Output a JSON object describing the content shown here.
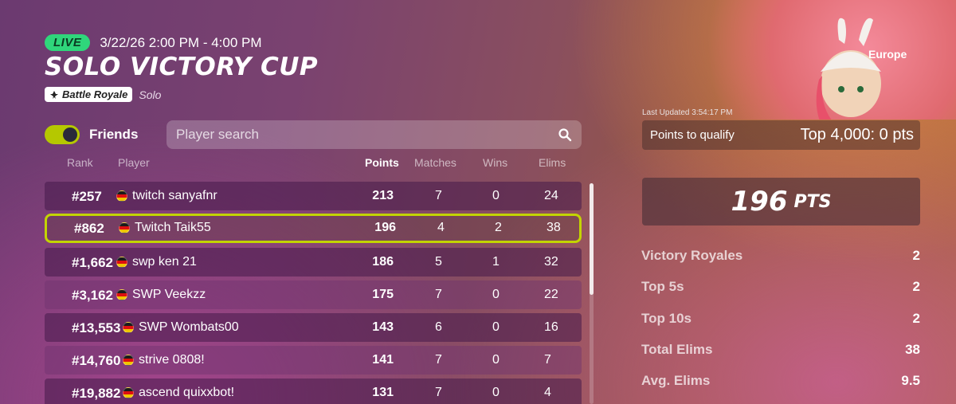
{
  "event": {
    "live_label": "LIVE",
    "time_range": "3/22/26 2:00 PM - 4:00 PM",
    "title": "SOLO VICTORY CUP",
    "mode": "Battle Royale",
    "mode_sub": "Solo"
  },
  "filters": {
    "friends_label": "Friends",
    "friends_on": true,
    "search_placeholder": "Player search"
  },
  "table": {
    "headers": {
      "rank": "Rank",
      "player": "Player",
      "points": "Points",
      "matches": "Matches",
      "wins": "Wins",
      "elims": "Elims"
    },
    "rows": [
      {
        "rank": "#257",
        "player": "twitch sanyafnr",
        "points": "213",
        "matches": "7",
        "wins": "0",
        "elims": "24"
      },
      {
        "rank": "#862",
        "player": "Twitch Taik55",
        "points": "196",
        "matches": "4",
        "wins": "2",
        "elims": "38"
      },
      {
        "rank": "#1,662",
        "player": "swp ken 21",
        "points": "186",
        "matches": "5",
        "wins": "1",
        "elims": "32"
      },
      {
        "rank": "#3,162",
        "player": "SWP Veekzz",
        "points": "175",
        "matches": "7",
        "wins": "0",
        "elims": "22"
      },
      {
        "rank": "#13,553",
        "player": "SWP Wombats00",
        "points": "143",
        "matches": "6",
        "wins": "0",
        "elims": "16"
      },
      {
        "rank": "#14,760",
        "player": "strive 0808!",
        "points": "141",
        "matches": "7",
        "wins": "0",
        "elims": "7"
      },
      {
        "rank": "#19,882",
        "player": "ascend quixxbot!",
        "points": "131",
        "matches": "7",
        "wins": "0",
        "elims": "4"
      }
    ]
  },
  "summary": {
    "region": "Europe",
    "last_updated": "Last Updated 3:54:17 PM",
    "qualify_label": "Points to qualify",
    "qualify_value": "Top 4,000: 0 pts",
    "points": "196",
    "points_unit": "PTS",
    "stats": [
      {
        "label": "Victory Royales",
        "value": "2"
      },
      {
        "label": "Top 5s",
        "value": "2"
      },
      {
        "label": "Top 10s",
        "value": "2"
      },
      {
        "label": "Total Elims",
        "value": "38"
      },
      {
        "label": "Avg. Elims",
        "value": "9.5"
      }
    ]
  },
  "colors": {
    "live_green": "#2fd67b",
    "highlight_yellow": "#c3d400",
    "toggle_on": "#b5c800"
  }
}
